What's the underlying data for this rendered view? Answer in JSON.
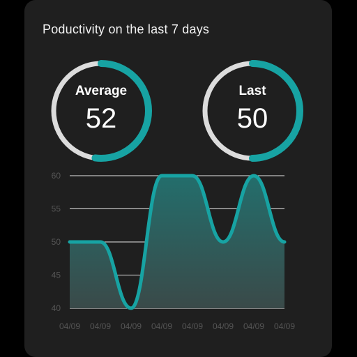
{
  "card": {
    "title": "Poductivity on the last 7 days"
  },
  "gauges": [
    {
      "label": "Average",
      "value": "52",
      "progress": 0.52
    },
    {
      "label": "Last",
      "value": "50",
      "progress": 0.5
    }
  ],
  "colors": {
    "accent": "#17a3a3",
    "track": "#dcdcdc",
    "card_bg": "#1f1f1f",
    "grid": "#e6e6e6",
    "tick": "#555555",
    "area_top": "#236e6c",
    "area_bottom": "#3a4a49"
  },
  "chart_data": {
    "type": "area",
    "categories": [
      "04/09",
      "04/09",
      "04/09",
      "04/09",
      "04/09",
      "04/09",
      "04/09",
      "04/09"
    ],
    "values": [
      50,
      50,
      40,
      60,
      60,
      50,
      60,
      50
    ],
    "title": "",
    "xlabel": "",
    "ylabel": "",
    "ylim": [
      40,
      60
    ],
    "yticks": [
      40,
      45,
      50,
      55,
      60
    ],
    "grid": true
  }
}
